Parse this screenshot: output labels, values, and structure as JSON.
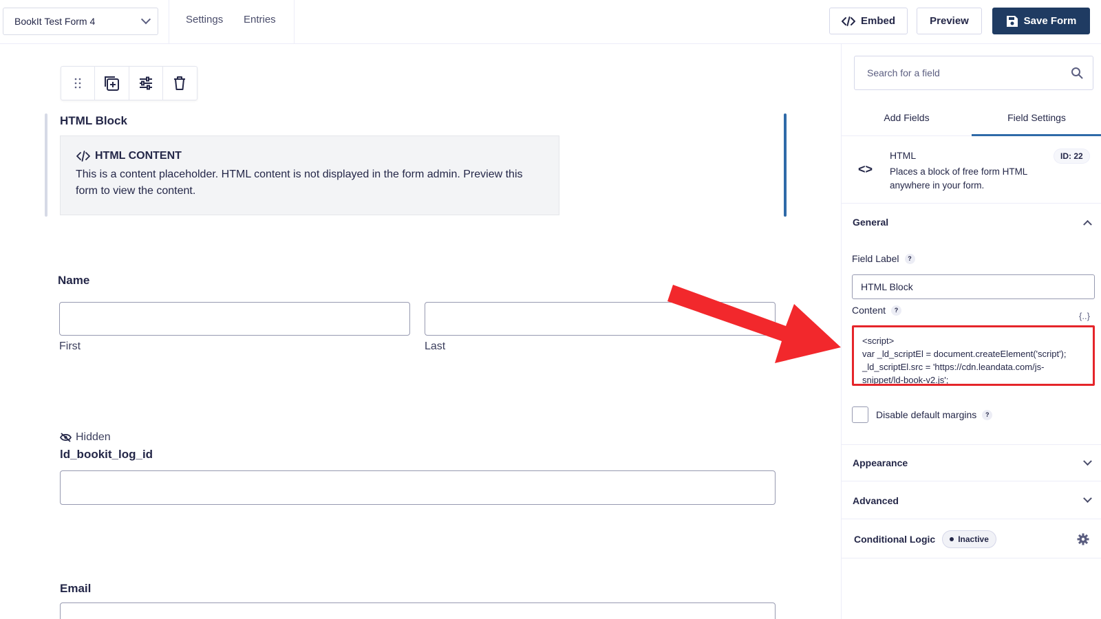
{
  "header": {
    "form_name": "BookIt Test Form 4",
    "links": [
      "Settings",
      "Entries"
    ],
    "embed_label": "Embed",
    "preview_label": "Preview",
    "save_label": "Save Form"
  },
  "canvas": {
    "html_block": {
      "label": "HTML Block",
      "content_title": "HTML CONTENT",
      "content_text": "This is a content placeholder. HTML content is not displayed in the form admin. Preview this form to view the content."
    },
    "name_field": {
      "label": "Name",
      "first_label": "First",
      "last_label": "Last"
    },
    "hidden_field": {
      "tag": "Hidden",
      "label": "ld_bookit_log_id"
    },
    "email_field": {
      "label": "Email"
    }
  },
  "sidebar": {
    "search_placeholder": "Search for a field",
    "tabs": [
      "Add Fields",
      "Field Settings"
    ],
    "active_tab": "Field Settings",
    "field": {
      "title": "HTML",
      "description": "Places a block of free form HTML anywhere in your form.",
      "id": "ID: 22"
    },
    "general": {
      "title": "General",
      "field_label_title": "Field Label",
      "field_label_value": "HTML Block",
      "content_title": "Content",
      "merge_tag": "{..}",
      "content_lines": [
        "<script>",
        "var _ld_scriptEl = document.createElement('script');",
        "_ld_scriptEl.src = 'https://cdn.leandata.com/js-",
        "snippet/ld-book-v2.js';"
      ],
      "disable_margins_label": "Disable default margins"
    },
    "appearance_title": "Appearance",
    "advanced_title": "Advanced",
    "conditional_logic": {
      "title": "Conditional Logic",
      "status": "Inactive"
    }
  },
  "colors": {
    "primary_button": "#1f3b62",
    "selection_bar": "#2f6aa8",
    "annotation_red": "#e5252a"
  }
}
